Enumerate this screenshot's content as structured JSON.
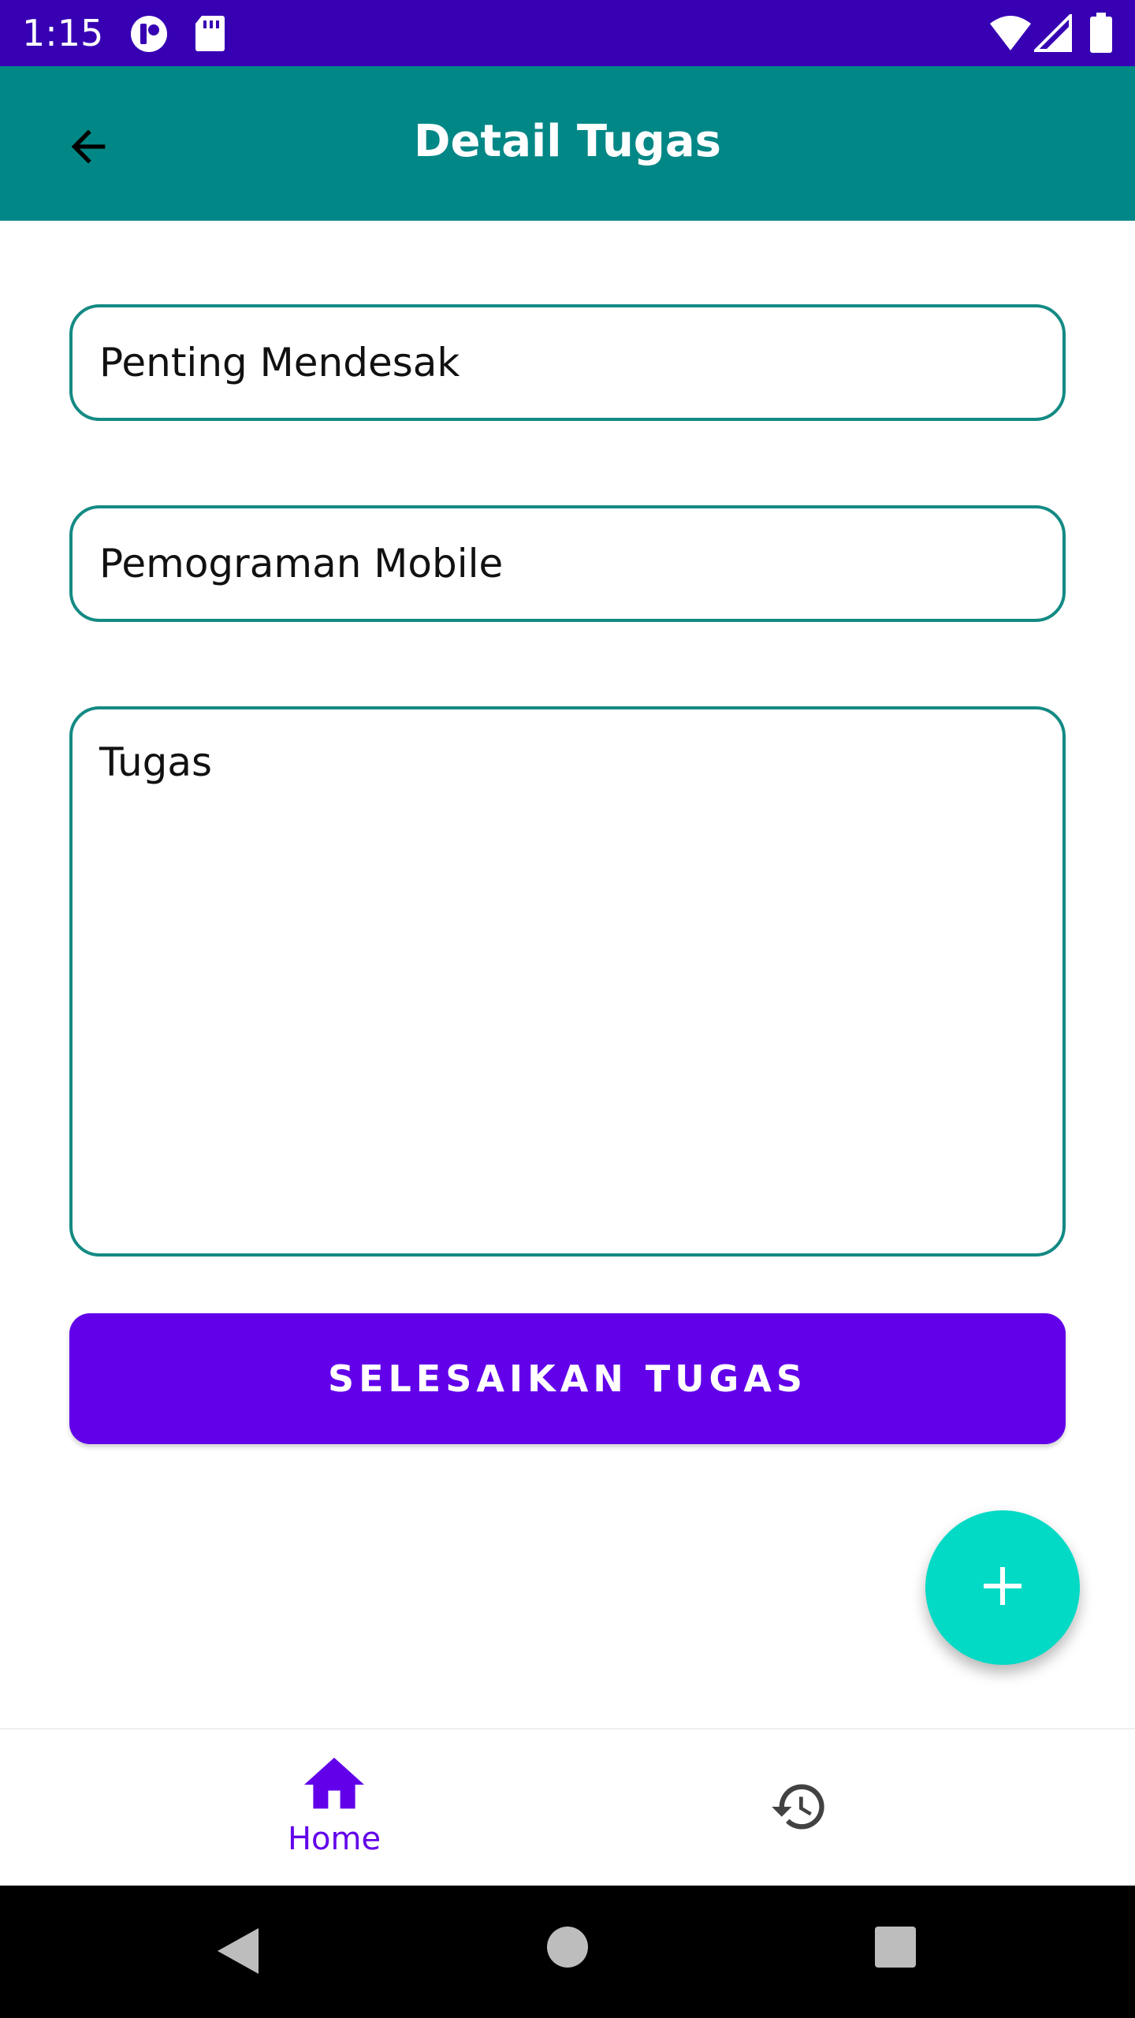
{
  "status_bar": {
    "time": "1:15",
    "background": "#3700b3",
    "icons": [
      "notification-app-icon",
      "sd-card-icon",
      "wifi-icon",
      "cell-signal-icon",
      "battery-icon"
    ]
  },
  "app_bar": {
    "title": "Detail Tugas",
    "background": "#018786",
    "back_icon": "arrow-back-icon"
  },
  "form": {
    "priority_value": "Penting Mendesak",
    "subject_value": "Pemograman Mobile",
    "task_value": "Tugas",
    "border_color": "#148a84"
  },
  "actions": {
    "complete_label": "SELESAIKAN TUGAS",
    "complete_color": "#6200ea",
    "fab_icon": "plus-icon",
    "fab_color": "#03dac5"
  },
  "bottom_nav": {
    "items": [
      {
        "label": "Home",
        "icon": "home-icon",
        "active": true
      },
      {
        "label": "",
        "icon": "history-icon",
        "active": false
      }
    ],
    "active_color": "#6200ea"
  },
  "system_nav": {
    "buttons": [
      "back-triangle-icon",
      "home-circle-icon",
      "recents-square-icon"
    ]
  }
}
